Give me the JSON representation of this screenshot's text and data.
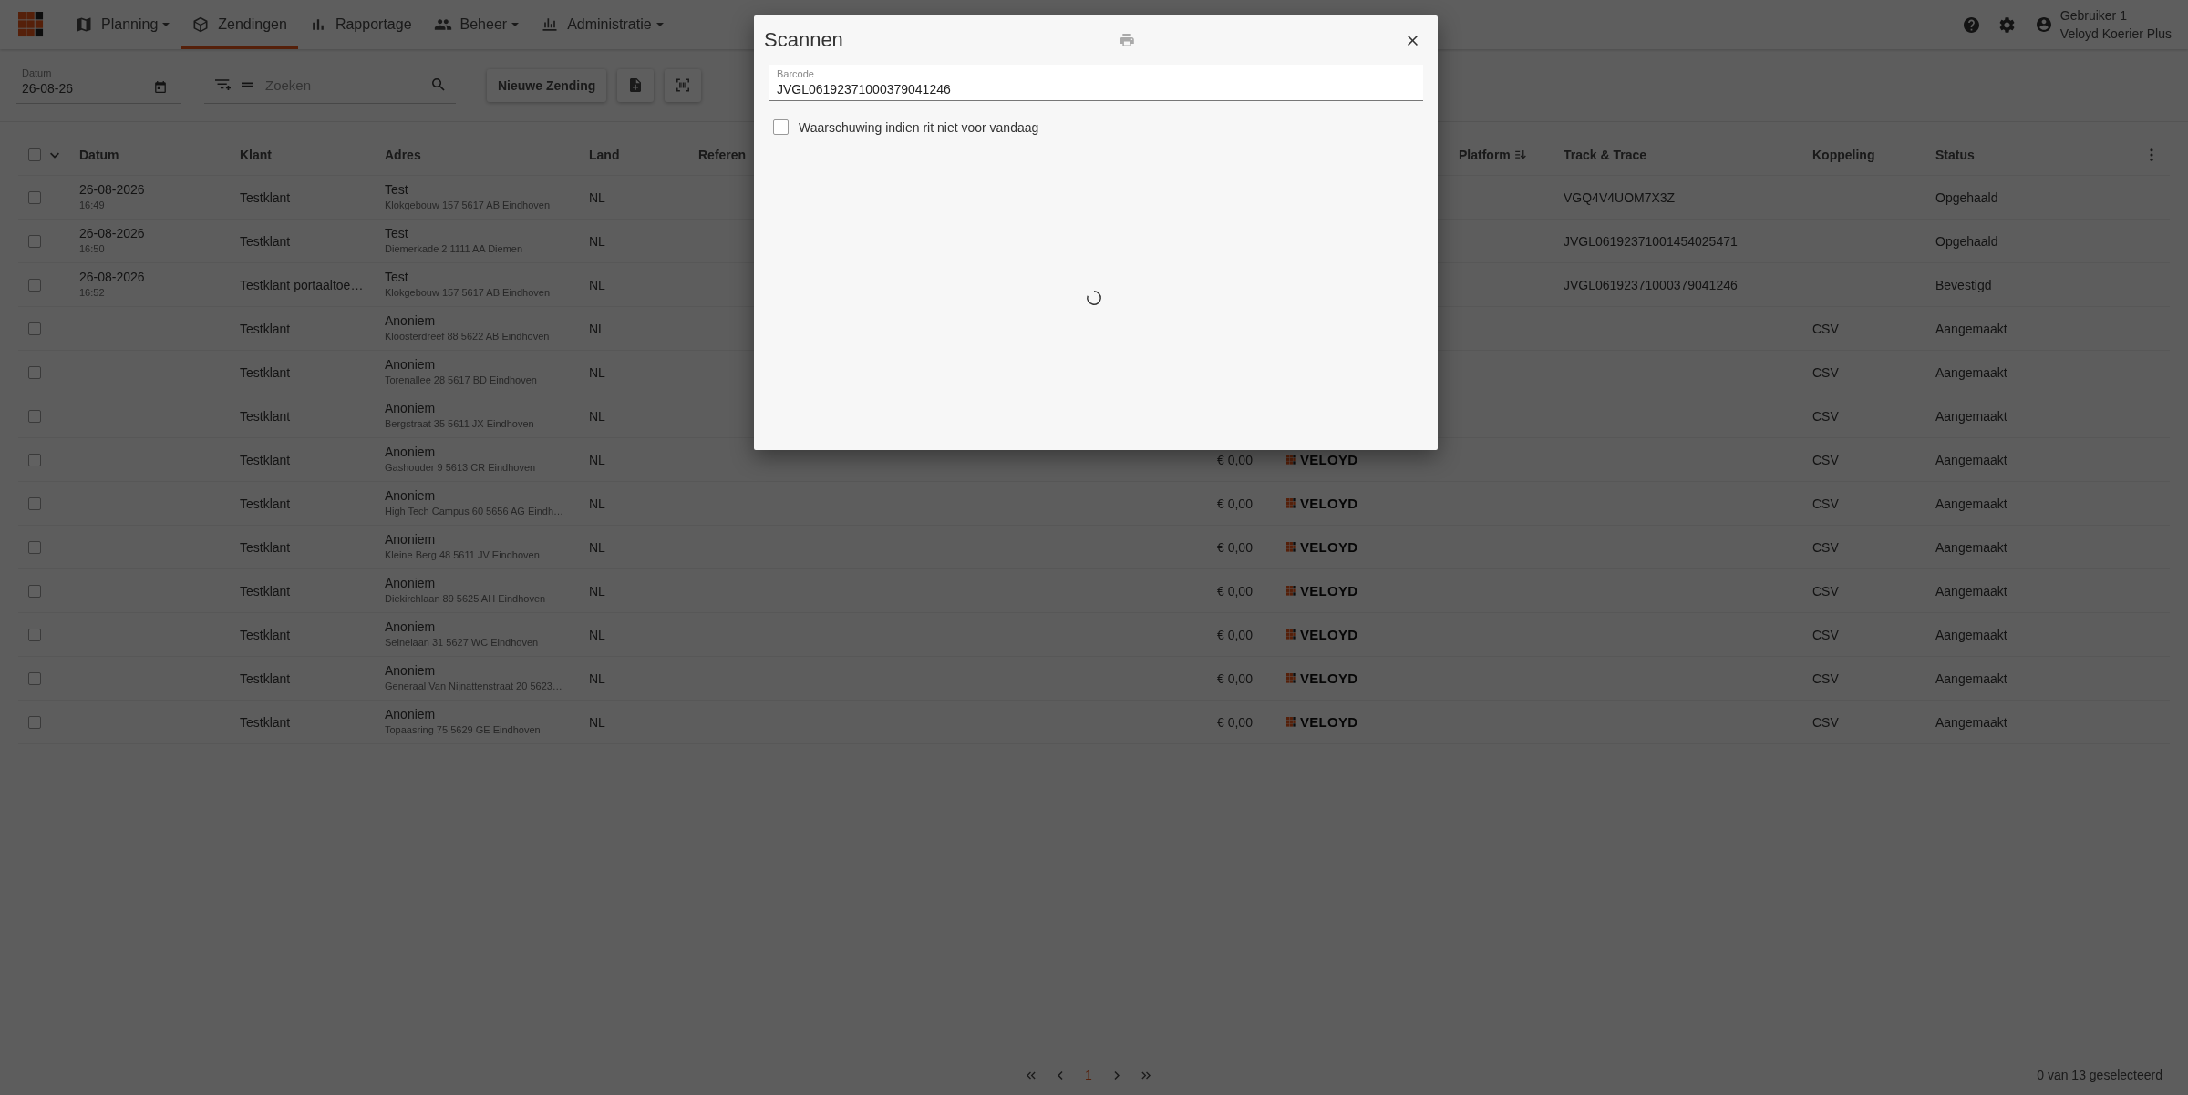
{
  "app_bar": {
    "nav": [
      {
        "label": "Planning",
        "dropdown": true,
        "selected": false
      },
      {
        "label": "Zendingen",
        "dropdown": false,
        "selected": true
      },
      {
        "label": "Rapportage",
        "dropdown": false,
        "selected": false
      },
      {
        "label": "Beheer",
        "dropdown": true,
        "selected": false
      },
      {
        "label": "Administratie",
        "dropdown": true,
        "selected": false
      }
    ],
    "user": {
      "name": "Gebruiker 1",
      "organisation": "Veloyd Koerier Plus"
    }
  },
  "toolbar": {
    "date_field": {
      "label": "Datum",
      "value": "26-08-26"
    },
    "search": {
      "placeholder": "Zoeken"
    },
    "new_button": "Nieuwe Zending"
  },
  "table": {
    "all_selected": false,
    "columns": [
      {
        "label": "Datum",
        "sorted": false
      },
      {
        "label": "Klant",
        "sorted": false
      },
      {
        "label": "Adres",
        "sorted": false
      },
      {
        "label": "Land",
        "sorted": false
      },
      {
        "label": "Referen",
        "sorted": false
      },
      {
        "label": "Platform",
        "sorted": true
      },
      {
        "label": "Track & Trace",
        "sorted": false
      },
      {
        "label": "Koppeling",
        "sorted": false
      },
      {
        "label": "Status",
        "sorted": false
      }
    ],
    "rows": [
      {
        "selected": false,
        "date": "26-08-2026",
        "time": "16:49",
        "client": "Testklant",
        "address_name": "Test",
        "address": "Klokgebouw 157 5617 AB Eindhoven",
        "country": "NL",
        "track_trace": "VGQ4V4UOM7X3Z",
        "status": "Opgehaald"
      },
      {
        "selected": false,
        "date": "26-08-2026",
        "time": "16:50",
        "client": "Testklant",
        "address_name": "Test",
        "address": "Diemerkade 2 1111 AA Diemen",
        "country": "NL",
        "track_trace": "JVGL06192371001454025471",
        "status": "Opgehaald"
      },
      {
        "selected": false,
        "date": "26-08-2026",
        "time": "16:52",
        "client": "Testklant portaaltoe…",
        "address_name": "Test",
        "address": "Klokgebouw 157 5617 AB Eindhoven",
        "country": "NL",
        "track_trace": "JVGL06192371000379041246",
        "status": "Bevestigd"
      },
      {
        "selected": false,
        "client": "Testklant",
        "address_name": "Anoniem",
        "address": "Kloosterdreef 88 5622 AB Eindhoven",
        "country": "NL",
        "link": "CSV",
        "status": "Aangemaakt"
      },
      {
        "selected": false,
        "client": "Testklant",
        "address_name": "Anoniem",
        "address": "Torenallee 28 5617 BD Eindhoven",
        "country": "NL",
        "link": "CSV",
        "status": "Aangemaakt"
      },
      {
        "selected": false,
        "client": "Testklant",
        "address_name": "Anoniem",
        "address": "Bergstraat 35 5611 JX Eindhoven",
        "country": "NL",
        "link": "CSV",
        "status": "Aangemaakt"
      },
      {
        "selected": false,
        "client": "Testklant",
        "address_name": "Anoniem",
        "address": "Gashouder 9 5613 CR Eindhoven",
        "country": "NL",
        "price": "€ 0,00",
        "carrier": "VELOYD",
        "link": "CSV",
        "status": "Aangemaakt"
      },
      {
        "selected": false,
        "client": "Testklant",
        "address_name": "Anoniem",
        "address": "High Tech Campus 60 5656 AG Eindh…",
        "country": "NL",
        "price": "€ 0,00",
        "carrier": "VELOYD",
        "link": "CSV",
        "status": "Aangemaakt"
      },
      {
        "selected": false,
        "client": "Testklant",
        "address_name": "Anoniem",
        "address": "Kleine Berg 48 5611 JV Eindhoven",
        "country": "NL",
        "price": "€ 0,00",
        "carrier": "VELOYD",
        "link": "CSV",
        "status": "Aangemaakt"
      },
      {
        "selected": false,
        "client": "Testklant",
        "address_name": "Anoniem",
        "address": "Diekirchlaan 89 5625 AH Eindhoven",
        "country": "NL",
        "price": "€ 0,00",
        "carrier": "VELOYD",
        "link": "CSV",
        "status": "Aangemaakt"
      },
      {
        "selected": false,
        "client": "Testklant",
        "address_name": "Anoniem",
        "address": "Seinelaan 31 5627 WC Eindhoven",
        "country": "NL",
        "price": "€ 0,00",
        "carrier": "VELOYD",
        "link": "CSV",
        "status": "Aangemaakt"
      },
      {
        "selected": false,
        "client": "Testklant",
        "address_name": "Anoniem",
        "address": "Generaal Van Nijnattenstraat 20 5623…",
        "country": "NL",
        "price": "€ 0,00",
        "carrier": "VELOYD",
        "link": "CSV",
        "status": "Aangemaakt"
      },
      {
        "selected": false,
        "client": "Testklant",
        "address_name": "Anoniem",
        "address": "Topaasring 75 5629 GE Eindhoven",
        "country": "NL",
        "price": "€ 0,00",
        "carrier": "VELOYD",
        "link": "CSV",
        "status": "Aangemaakt"
      }
    ]
  },
  "pagination": {
    "pages": [
      {
        "label": "1",
        "selected": true
      }
    ],
    "selection_count": "0 van 13 geselecteerd"
  },
  "modal": {
    "title": "Scannen",
    "barcode": {
      "label": "Barcode",
      "value": "JVGL06192371000379041246"
    },
    "warning": {
      "label": "Waarschuwing indien rit niet voor vandaag",
      "checked": false
    },
    "loading": true
  }
}
